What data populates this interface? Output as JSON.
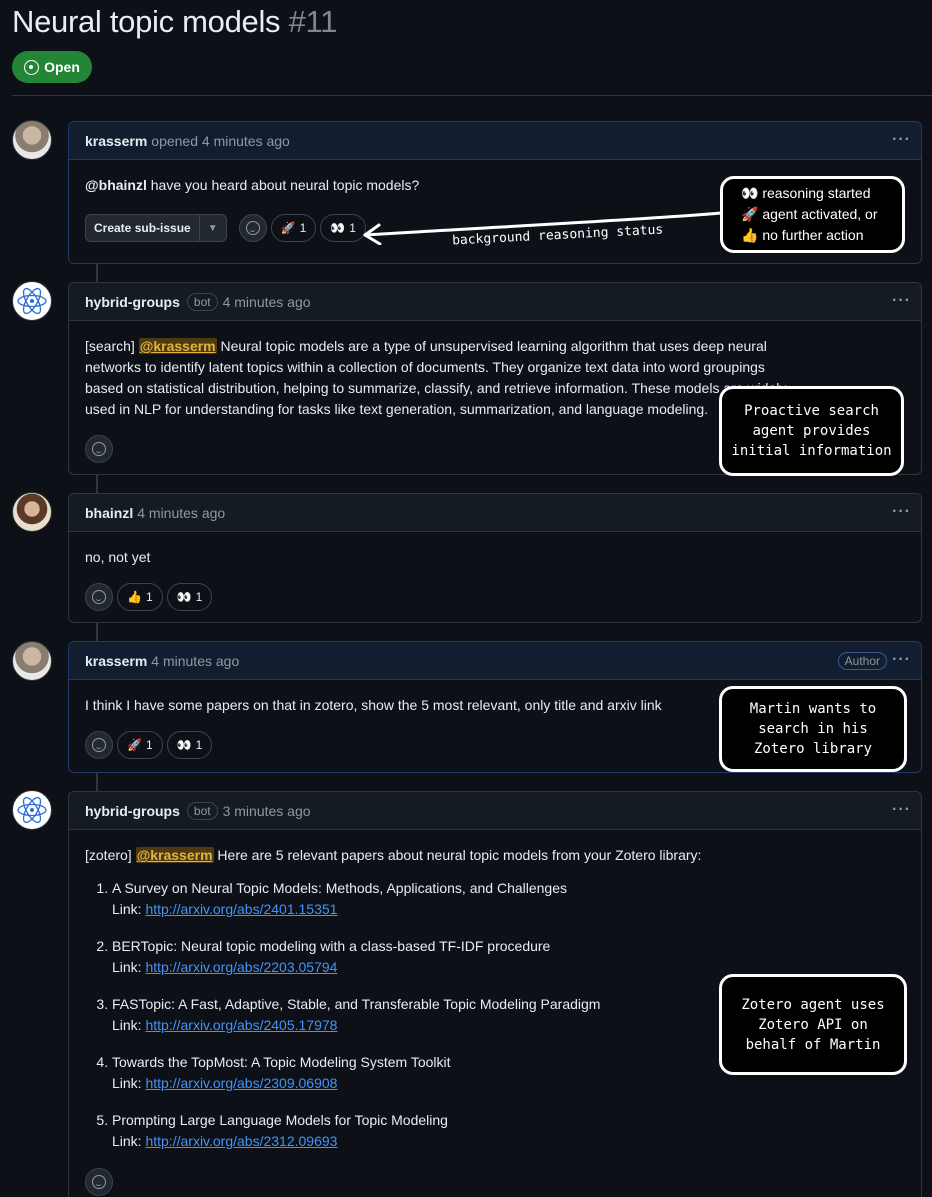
{
  "issue": {
    "title": "Neural topic models",
    "number": "#11",
    "state": "Open"
  },
  "comments": [
    {
      "author": "krasserm",
      "action": "opened",
      "time": "4 minutes ago",
      "mention": "@bhainzl",
      "text": " have you heard about neural topic models?",
      "sub_issue_label": "Create sub-issue",
      "reactions": [
        {
          "emoji": "🚀",
          "count": "1"
        },
        {
          "emoji": "👀",
          "count": "1"
        }
      ]
    },
    {
      "author": "hybrid-groups",
      "bot_label": "bot",
      "time": "4 minutes ago",
      "prefix": "[search] ",
      "mention": "@krasserm",
      "text": " Neural topic models are a type of unsupervised learning algorithm that uses deep neural networks to identify latent topics within a collection of documents. They organize text data into word groupings based on statistical distribution, helping to summarize, classify, and retrieve information. These models are widely used in NLP for understanding for tasks like text generation, summarization, and language modeling."
    },
    {
      "author": "bhainzl",
      "time": "4 minutes ago",
      "text": "no, not yet",
      "reactions": [
        {
          "emoji": "👍",
          "count": "1"
        },
        {
          "emoji": "👀",
          "count": "1"
        }
      ]
    },
    {
      "author": "krasserm",
      "time": "4 minutes ago",
      "role_label": "Author",
      "text": "I think I have some papers on that in zotero, show the 5 most relevant, only title and arxiv link",
      "reactions": [
        {
          "emoji": "🚀",
          "count": "1"
        },
        {
          "emoji": "👀",
          "count": "1"
        }
      ]
    },
    {
      "author": "hybrid-groups",
      "bot_label": "bot",
      "time": "3 minutes ago",
      "prefix": "[zotero] ",
      "mention": "@krasserm",
      "text": " Here are 5 relevant papers about neural topic models from your Zotero library:",
      "link_prefix": "Link: ",
      "papers": [
        {
          "title": "A Survey on Neural Topic Models: Methods, Applications, and Challenges",
          "link": "http://arxiv.org/abs/2401.15351"
        },
        {
          "title": "BERTopic: Neural topic modeling with a class-based TF-IDF procedure",
          "link": "http://arxiv.org/abs/2203.05794"
        },
        {
          "title": "FASTopic: A Fast, Adaptive, Stable, and Transferable Topic Modeling Paradigm",
          "link": "http://arxiv.org/abs/2405.17978"
        },
        {
          "title": "Towards the TopMost: A Topic Modeling System Toolkit",
          "link": "http://arxiv.org/abs/2309.06908"
        },
        {
          "title": "Prompting Large Language Models for Topic Modeling",
          "link": "http://arxiv.org/abs/2312.09693"
        }
      ]
    }
  ],
  "annotations": {
    "status_list": [
      "👀 reasoning started",
      "🚀 agent activated, or",
      "👍 no further action"
    ],
    "arrow_label": "background reasoning status",
    "search_note": [
      "Proactive search",
      "agent provides",
      "initial information"
    ],
    "martin_note": [
      "Martin wants to",
      "search in his",
      "Zotero library"
    ],
    "zotero_note": [
      "Zotero agent uses",
      "Zotero API on",
      "behalf of Martin"
    ]
  },
  "colors": {
    "open_badge": "#238636",
    "link": "#4493f8",
    "mention_highlight": "#e3b341",
    "background": "#0d1117"
  }
}
